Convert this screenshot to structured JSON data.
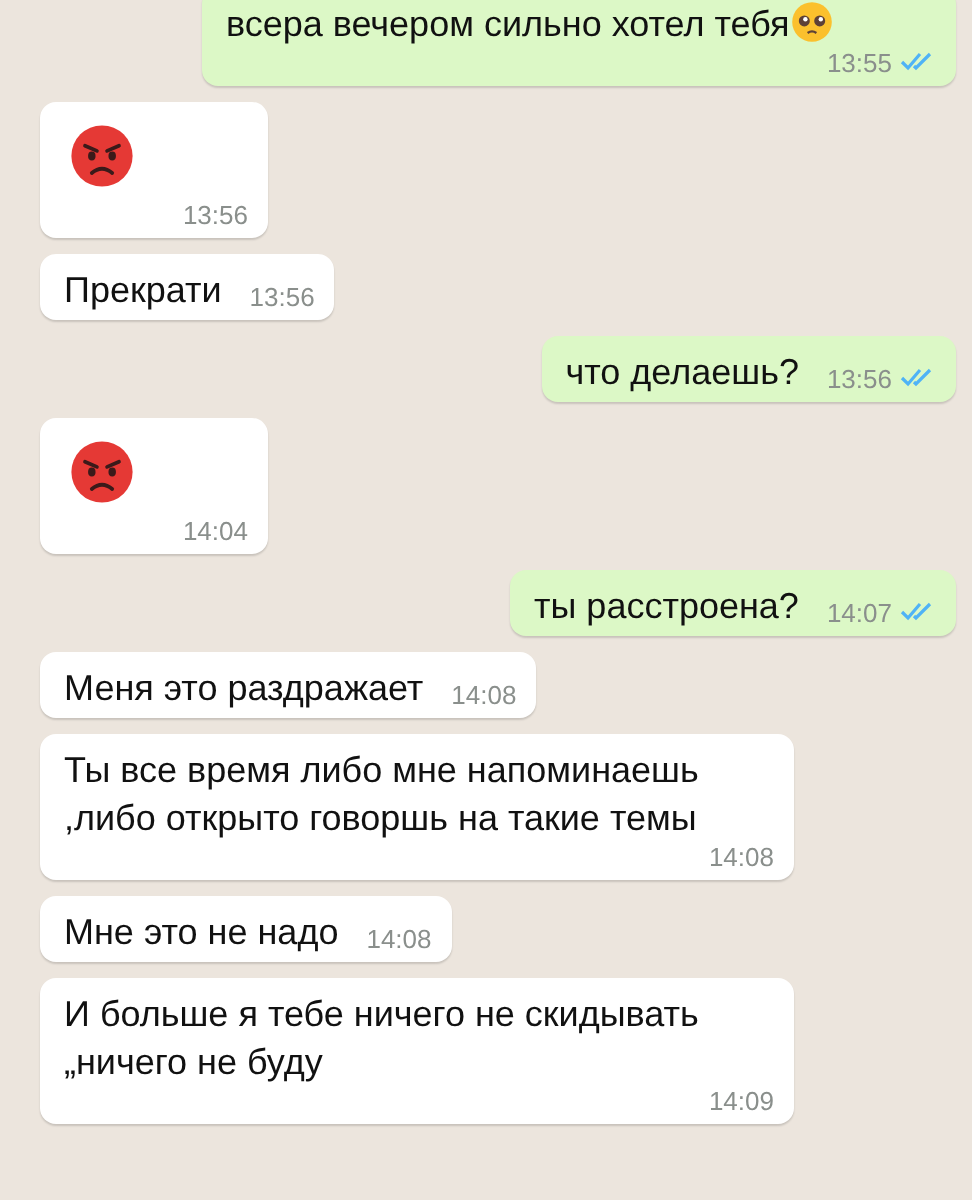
{
  "messages": [
    {
      "outgoing": true,
      "kind": "text",
      "text": "всера вечером сильно хотел тебя",
      "has_emoji": true,
      "time": "13:55",
      "read": true
    },
    {
      "outgoing": false,
      "kind": "emoji",
      "time": "13:56"
    },
    {
      "outgoing": false,
      "kind": "text",
      "text": "Прекрати",
      "time": "13:56"
    },
    {
      "outgoing": true,
      "kind": "text",
      "text": "что делаешь?",
      "time": "13:56",
      "read": true
    },
    {
      "outgoing": false,
      "kind": "emoji",
      "time": "14:04"
    },
    {
      "outgoing": true,
      "kind": "text",
      "text": "ты расстроена?",
      "time": "14:07",
      "read": true
    },
    {
      "outgoing": false,
      "kind": "text",
      "text": "Меня это раздражает",
      "time": "14:08"
    },
    {
      "outgoing": false,
      "kind": "text",
      "text": "Ты все время либо мне напоминаешь ,либо открыто говоршь на такие темы",
      "time": "14:08"
    },
    {
      "outgoing": false,
      "kind": "text",
      "text": "Мне это не надо",
      "time": "14:08"
    },
    {
      "outgoing": false,
      "kind": "text",
      "text": "И больше я тебе ничего не скидывать „ничего не буду",
      "time": "14:09"
    }
  ]
}
